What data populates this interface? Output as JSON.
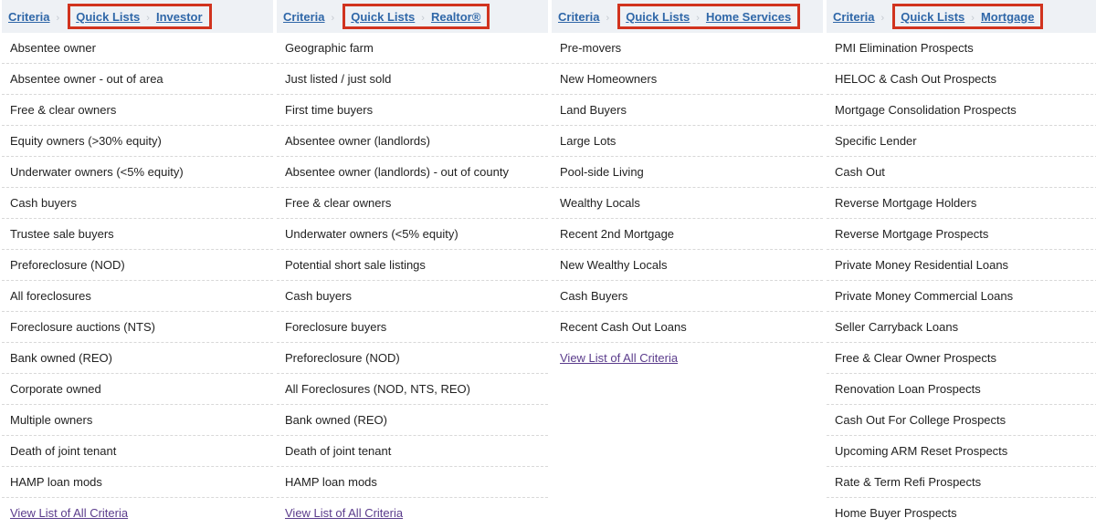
{
  "colors": {
    "link": "#2f67a8",
    "visited_link": "#5b3c8c",
    "highlight_border": "#d1331e",
    "header_bg": "#eef1f5"
  },
  "panels": [
    {
      "breadcrumb": {
        "root": "Criteria",
        "section": "Quick Lists",
        "current": "Investor"
      },
      "items": [
        "Absentee owner",
        "Absentee owner - out of area",
        "Free & clear owners",
        "Equity owners (>30% equity)",
        "Underwater owners (<5% equity)",
        "Cash buyers",
        "Trustee sale buyers",
        "Preforeclosure (NOD)",
        "All foreclosures",
        "Foreclosure auctions (NTS)",
        "Bank owned (REO)",
        "Corporate owned",
        "Multiple owners",
        "Death of joint tenant",
        "HAMP loan mods"
      ],
      "view_all": "View List of All Criteria"
    },
    {
      "breadcrumb": {
        "root": "Criteria",
        "section": "Quick Lists",
        "current": "Realtor®"
      },
      "items": [
        "Geographic farm",
        "Just listed / just sold",
        "First time buyers",
        "Absentee owner (landlords)",
        "Absentee owner (landlords) - out of county",
        "Free & clear owners",
        "Underwater owners (<5% equity)",
        "Potential short sale listings",
        "Cash buyers",
        "Foreclosure buyers",
        "Preforeclosure (NOD)",
        "All Foreclosures (NOD, NTS, REO)",
        "Bank owned (REO)",
        "Death of joint tenant",
        "HAMP loan mods"
      ],
      "view_all": "View List of All Criteria"
    },
    {
      "breadcrumb": {
        "root": "Criteria",
        "section": "Quick Lists",
        "current": "Home Services"
      },
      "items": [
        "Pre-movers",
        "New Homeowners",
        "Land Buyers",
        "Large Lots",
        "Pool-side Living",
        "Wealthy Locals",
        "Recent 2nd Mortgage",
        "New Wealthy Locals",
        "Cash Buyers",
        "Recent Cash Out Loans"
      ],
      "view_all": "View List of All Criteria"
    },
    {
      "breadcrumb": {
        "root": "Criteria",
        "section": "Quick Lists",
        "current": "Mortgage"
      },
      "items": [
        "PMI Elimination Prospects",
        "HELOC & Cash Out Prospects",
        "Mortgage Consolidation Prospects",
        "Specific Lender",
        "Cash Out",
        "Reverse Mortgage Holders",
        "Reverse Mortgage Prospects",
        "Private Money Residential Loans",
        "Private Money Commercial Loans",
        "Seller Carryback Loans",
        "Free & Clear Owner Prospects",
        "Renovation Loan Prospects",
        "Cash Out For College Prospects",
        "Upcoming ARM Reset Prospects",
        "Rate & Term Refi Prospects",
        "Home Buyer Prospects"
      ],
      "view_all": null
    }
  ]
}
